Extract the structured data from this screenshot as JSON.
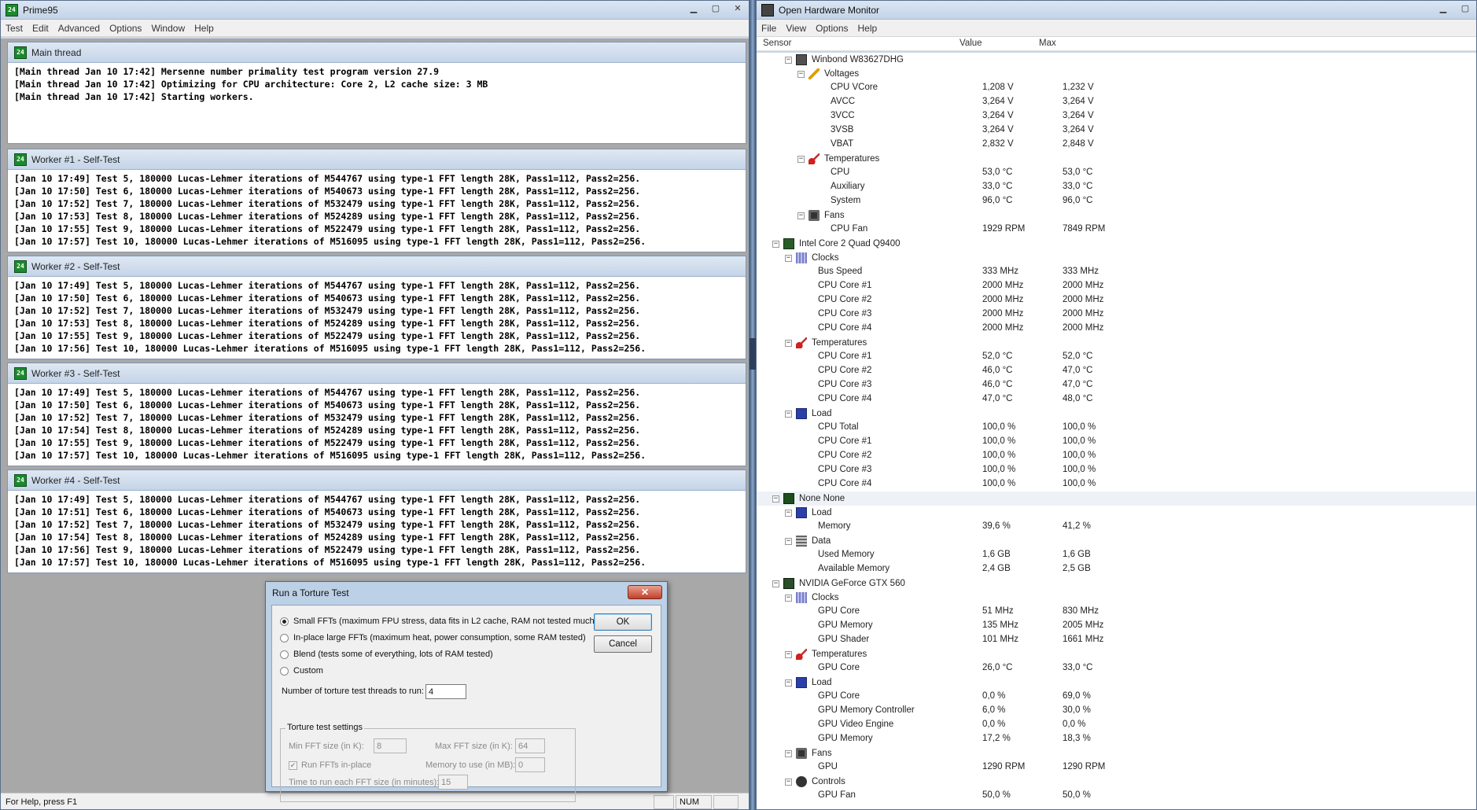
{
  "prime95": {
    "title": "Prime95",
    "menu": [
      "Test",
      "Edit",
      "Advanced",
      "Options",
      "Window",
      "Help"
    ],
    "main_thread": {
      "title": "Main thread",
      "lines": [
        "[Main thread Jan 10 17:42] Mersenne number primality test program version 27.9",
        "[Main thread Jan 10 17:42] Optimizing for CPU architecture: Core 2, L2 cache size: 3 MB",
        "[Main thread Jan 10 17:42] Starting workers."
      ]
    },
    "workers": [
      {
        "title": "Worker #1 - Self-Test",
        "lines": [
          "[Jan 10 17:49] Test 5, 180000 Lucas-Lehmer iterations of M544767 using type-1 FFT length 28K, Pass1=112, Pass2=256.",
          "[Jan 10 17:50] Test 6, 180000 Lucas-Lehmer iterations of M540673 using type-1 FFT length 28K, Pass1=112, Pass2=256.",
          "[Jan 10 17:52] Test 7, 180000 Lucas-Lehmer iterations of M532479 using type-1 FFT length 28K, Pass1=112, Pass2=256.",
          "[Jan 10 17:53] Test 8, 180000 Lucas-Lehmer iterations of M524289 using type-1 FFT length 28K, Pass1=112, Pass2=256.",
          "[Jan 10 17:55] Test 9, 180000 Lucas-Lehmer iterations of M522479 using type-1 FFT length 28K, Pass1=112, Pass2=256.",
          "[Jan 10 17:57] Test 10, 180000 Lucas-Lehmer iterations of M516095 using type-1 FFT length 28K, Pass1=112, Pass2=256."
        ]
      },
      {
        "title": "Worker #2 - Self-Test",
        "lines": [
          "[Jan 10 17:49] Test 5, 180000 Lucas-Lehmer iterations of M544767 using type-1 FFT length 28K, Pass1=112, Pass2=256.",
          "[Jan 10 17:50] Test 6, 180000 Lucas-Lehmer iterations of M540673 using type-1 FFT length 28K, Pass1=112, Pass2=256.",
          "[Jan 10 17:52] Test 7, 180000 Lucas-Lehmer iterations of M532479 using type-1 FFT length 28K, Pass1=112, Pass2=256.",
          "[Jan 10 17:53] Test 8, 180000 Lucas-Lehmer iterations of M524289 using type-1 FFT length 28K, Pass1=112, Pass2=256.",
          "[Jan 10 17:55] Test 9, 180000 Lucas-Lehmer iterations of M522479 using type-1 FFT length 28K, Pass1=112, Pass2=256.",
          "[Jan 10 17:56] Test 10, 180000 Lucas-Lehmer iterations of M516095 using type-1 FFT length 28K, Pass1=112, Pass2=256."
        ]
      },
      {
        "title": "Worker #3 - Self-Test",
        "lines": [
          "[Jan 10 17:49] Test 5, 180000 Lucas-Lehmer iterations of M544767 using type-1 FFT length 28K, Pass1=112, Pass2=256.",
          "[Jan 10 17:50] Test 6, 180000 Lucas-Lehmer iterations of M540673 using type-1 FFT length 28K, Pass1=112, Pass2=256.",
          "[Jan 10 17:52] Test 7, 180000 Lucas-Lehmer iterations of M532479 using type-1 FFT length 28K, Pass1=112, Pass2=256.",
          "[Jan 10 17:54] Test 8, 180000 Lucas-Lehmer iterations of M524289 using type-1 FFT length 28K, Pass1=112, Pass2=256.",
          "[Jan 10 17:55] Test 9, 180000 Lucas-Lehmer iterations of M522479 using type-1 FFT length 28K, Pass1=112, Pass2=256.",
          "[Jan 10 17:57] Test 10, 180000 Lucas-Lehmer iterations of M516095 using type-1 FFT length 28K, Pass1=112, Pass2=256."
        ]
      },
      {
        "title": "Worker #4 - Self-Test",
        "lines": [
          "[Jan 10 17:49] Test 5, 180000 Lucas-Lehmer iterations of M544767 using type-1 FFT length 28K, Pass1=112, Pass2=256.",
          "[Jan 10 17:51] Test 6, 180000 Lucas-Lehmer iterations of M540673 using type-1 FFT length 28K, Pass1=112, Pass2=256.",
          "[Jan 10 17:52] Test 7, 180000 Lucas-Lehmer iterations of M532479 using type-1 FFT length 28K, Pass1=112, Pass2=256.",
          "[Jan 10 17:54] Test 8, 180000 Lucas-Lehmer iterations of M524289 using type-1 FFT length 28K, Pass1=112, Pass2=256.",
          "[Jan 10 17:56] Test 9, 180000 Lucas-Lehmer iterations of M522479 using type-1 FFT length 28K, Pass1=112, Pass2=256.",
          "[Jan 10 17:57] Test 10, 180000 Lucas-Lehmer iterations of M516095 using type-1 FFT length 28K, Pass1=112, Pass2=256."
        ]
      }
    ],
    "status": "For Help, press F1",
    "status_num": "NUM"
  },
  "dialog": {
    "title": "Run a Torture Test",
    "options": [
      {
        "label": "Small FFTs (maximum FPU stress, data fits in L2 cache, RAM not tested much)",
        "selected": true
      },
      {
        "label": "In-place large FFTs (maximum heat, power consumption, some RAM tested)",
        "selected": false
      },
      {
        "label": "Blend (tests some of everything, lots of RAM tested)",
        "selected": false
      },
      {
        "label": "Custom",
        "selected": false
      }
    ],
    "threads_label": "Number of torture test threads to run:",
    "threads_value": "4",
    "ok": "OK",
    "cancel": "Cancel",
    "settings_label": "Torture test settings",
    "min_fft_label": "Min FFT size (in K):",
    "min_fft_value": "8",
    "max_fft_label": "Max FFT size (in K):",
    "max_fft_value": "64",
    "inplace_label": "Run FFTs in-place",
    "memory_label": "Memory to use (in MB):",
    "memory_value": "0",
    "time_label": "Time to run each FFT size (in minutes):",
    "time_value": "15"
  },
  "ohm": {
    "title": "Open Hardware Monitor",
    "menu": [
      "File",
      "View",
      "Options",
      "Help"
    ],
    "columns": {
      "sensor": "Sensor",
      "value": "Value",
      "max": "Max"
    },
    "rows": [
      {
        "level": 2,
        "icon": "chip",
        "label": "Winbond W83627DHG",
        "exp": "−"
      },
      {
        "level": 3,
        "icon": "volt",
        "label": "Voltages",
        "exp": "−"
      },
      {
        "level": 4,
        "label": "CPU VCore",
        "value": "1,208 V",
        "max": "1,232 V"
      },
      {
        "level": 4,
        "label": "AVCC",
        "value": "3,264 V",
        "max": "3,264 V"
      },
      {
        "level": 4,
        "label": "3VCC",
        "value": "3,264 V",
        "max": "3,264 V"
      },
      {
        "level": 4,
        "label": "3VSB",
        "value": "3,264 V",
        "max": "3,264 V"
      },
      {
        "level": 4,
        "label": "VBAT",
        "value": "2,832 V",
        "max": "2,848 V"
      },
      {
        "level": 3,
        "icon": "temp",
        "label": "Temperatures",
        "exp": "−"
      },
      {
        "level": 4,
        "label": "CPU",
        "value": "53,0 °C",
        "max": "53,0 °C"
      },
      {
        "level": 4,
        "label": "Auxiliary",
        "value": "33,0 °C",
        "max": "33,0 °C"
      },
      {
        "level": 4,
        "label": "System",
        "value": "96,0 °C",
        "max": "96,0 °C"
      },
      {
        "level": 3,
        "icon": "fan",
        "label": "Fans",
        "exp": "−"
      },
      {
        "level": 4,
        "label": "CPU Fan",
        "value": "1929 RPM",
        "max": "7849 RPM"
      },
      {
        "level": 1,
        "icon": "cpu",
        "label": "Intel Core 2 Quad Q9400",
        "exp": "−"
      },
      {
        "level": 2,
        "icon": "clock",
        "label": "Clocks",
        "exp": "−"
      },
      {
        "level": 3,
        "label": "Bus Speed",
        "value": "333 MHz",
        "max": "333 MHz"
      },
      {
        "level": 3,
        "label": "CPU Core #1",
        "value": "2000 MHz",
        "max": "2000 MHz"
      },
      {
        "level": 3,
        "label": "CPU Core #2",
        "value": "2000 MHz",
        "max": "2000 MHz"
      },
      {
        "level": 3,
        "label": "CPU Core #3",
        "value": "2000 MHz",
        "max": "2000 MHz"
      },
      {
        "level": 3,
        "label": "CPU Core #4",
        "value": "2000 MHz",
        "max": "2000 MHz"
      },
      {
        "level": 2,
        "icon": "temp",
        "label": "Temperatures",
        "exp": "−"
      },
      {
        "level": 3,
        "label": "CPU Core #1",
        "value": "52,0 °C",
        "max": "52,0 °C"
      },
      {
        "level": 3,
        "label": "CPU Core #2",
        "value": "46,0 °C",
        "max": "47,0 °C"
      },
      {
        "level": 3,
        "label": "CPU Core #3",
        "value": "46,0 °C",
        "max": "47,0 °C"
      },
      {
        "level": 3,
        "label": "CPU Core #4",
        "value": "47,0 °C",
        "max": "48,0 °C"
      },
      {
        "level": 2,
        "icon": "load",
        "label": "Load",
        "exp": "−"
      },
      {
        "level": 3,
        "label": "CPU Total",
        "value": "100,0 %",
        "max": "100,0 %"
      },
      {
        "level": 3,
        "label": "CPU Core #1",
        "value": "100,0 %",
        "max": "100,0 %"
      },
      {
        "level": 3,
        "label": "CPU Core #2",
        "value": "100,0 %",
        "max": "100,0 %"
      },
      {
        "level": 3,
        "label": "CPU Core #3",
        "value": "100,0 %",
        "max": "100,0 %"
      },
      {
        "level": 3,
        "label": "CPU Core #4",
        "value": "100,0 %",
        "max": "100,0 %"
      },
      {
        "level": 1,
        "icon": "ram",
        "label": "None None",
        "exp": "−",
        "sel": true
      },
      {
        "level": 2,
        "icon": "load",
        "label": "Load",
        "exp": "−"
      },
      {
        "level": 3,
        "label": "Memory",
        "value": "39,6 %",
        "max": "41,2 %"
      },
      {
        "level": 2,
        "icon": "data",
        "label": "Data",
        "exp": "−"
      },
      {
        "level": 3,
        "label": "Used Memory",
        "value": "1,6 GB",
        "max": "1,6 GB"
      },
      {
        "level": 3,
        "label": "Available Memory",
        "value": "2,4 GB",
        "max": "2,5 GB"
      },
      {
        "level": 1,
        "icon": "gpu",
        "label": "NVIDIA GeForce GTX 560",
        "exp": "−"
      },
      {
        "level": 2,
        "icon": "clock",
        "label": "Clocks",
        "exp": "−"
      },
      {
        "level": 3,
        "label": "GPU Core",
        "value": "51 MHz",
        "max": "830 MHz"
      },
      {
        "level": 3,
        "label": "GPU Memory",
        "value": "135 MHz",
        "max": "2005 MHz"
      },
      {
        "level": 3,
        "label": "GPU Shader",
        "value": "101 MHz",
        "max": "1661 MHz"
      },
      {
        "level": 2,
        "icon": "temp",
        "label": "Temperatures",
        "exp": "−"
      },
      {
        "level": 3,
        "label": "GPU Core",
        "value": "26,0 °C",
        "max": "33,0 °C"
      },
      {
        "level": 2,
        "icon": "load",
        "label": "Load",
        "exp": "−"
      },
      {
        "level": 3,
        "label": "GPU Core",
        "value": "0,0 %",
        "max": "69,0 %"
      },
      {
        "level": 3,
        "label": "GPU Memory Controller",
        "value": "6,0 %",
        "max": "30,0 %"
      },
      {
        "level": 3,
        "label": "GPU Video Engine",
        "value": "0,0 %",
        "max": "0,0 %"
      },
      {
        "level": 3,
        "label": "GPU Memory",
        "value": "17,2 %",
        "max": "18,3 %"
      },
      {
        "level": 2,
        "icon": "fan",
        "label": "Fans",
        "exp": "−"
      },
      {
        "level": 3,
        "label": "GPU",
        "value": "1290 RPM",
        "max": "1290 RPM"
      },
      {
        "level": 2,
        "icon": "ctrl",
        "label": "Controls",
        "exp": "−"
      },
      {
        "level": 3,
        "label": "GPU Fan",
        "value": "50,0 %",
        "max": "50,0 %"
      }
    ]
  }
}
